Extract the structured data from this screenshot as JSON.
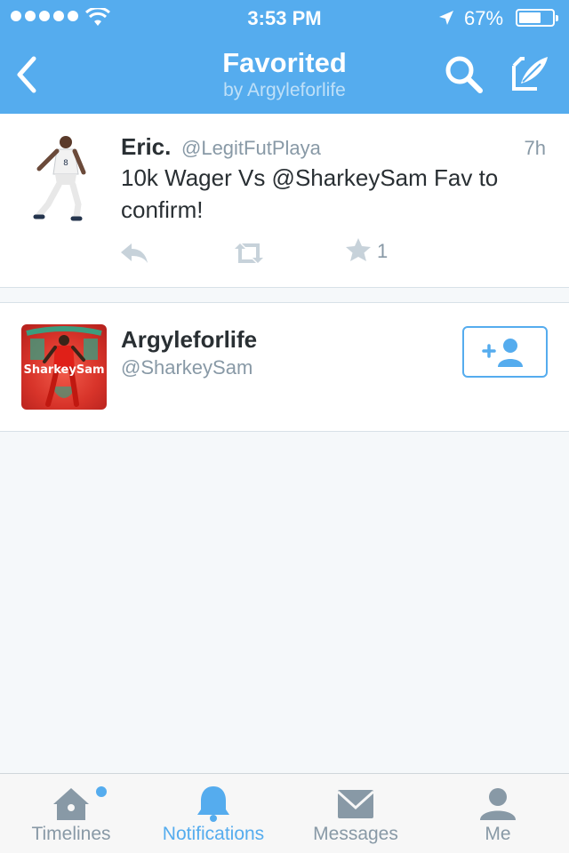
{
  "status_bar": {
    "time": "3:53 PM",
    "battery_percent": "67%",
    "battery_level": 0.67
  },
  "header": {
    "title": "Favorited",
    "subtitle": "by Argyleforlife",
    "back_icon": "chevron-left-icon",
    "search_icon": "search-icon",
    "compose_icon": "compose-icon",
    "bg_color": "#55acee"
  },
  "tweet": {
    "name": "Eric.",
    "handle": "@LegitFutPlaya",
    "time": "7h",
    "text": "10k Wager Vs @SharkeySam Fav to confirm!",
    "favorite_count": "1"
  },
  "user": {
    "name": "Argyleforlife",
    "handle": "@SharkeySam",
    "avatar_caption": "SharkeySam"
  },
  "tabs": [
    {
      "label": "Timelines",
      "icon": "home-icon",
      "active": false,
      "has_dot": true
    },
    {
      "label": "Notifications",
      "icon": "bell-icon",
      "active": true
    },
    {
      "label": "Messages",
      "icon": "envelope-icon",
      "active": false
    },
    {
      "label": "Me",
      "icon": "person-icon",
      "active": false
    }
  ],
  "colors": {
    "accent": "#55acee",
    "muted": "#8899a6",
    "text": "#292f33"
  }
}
